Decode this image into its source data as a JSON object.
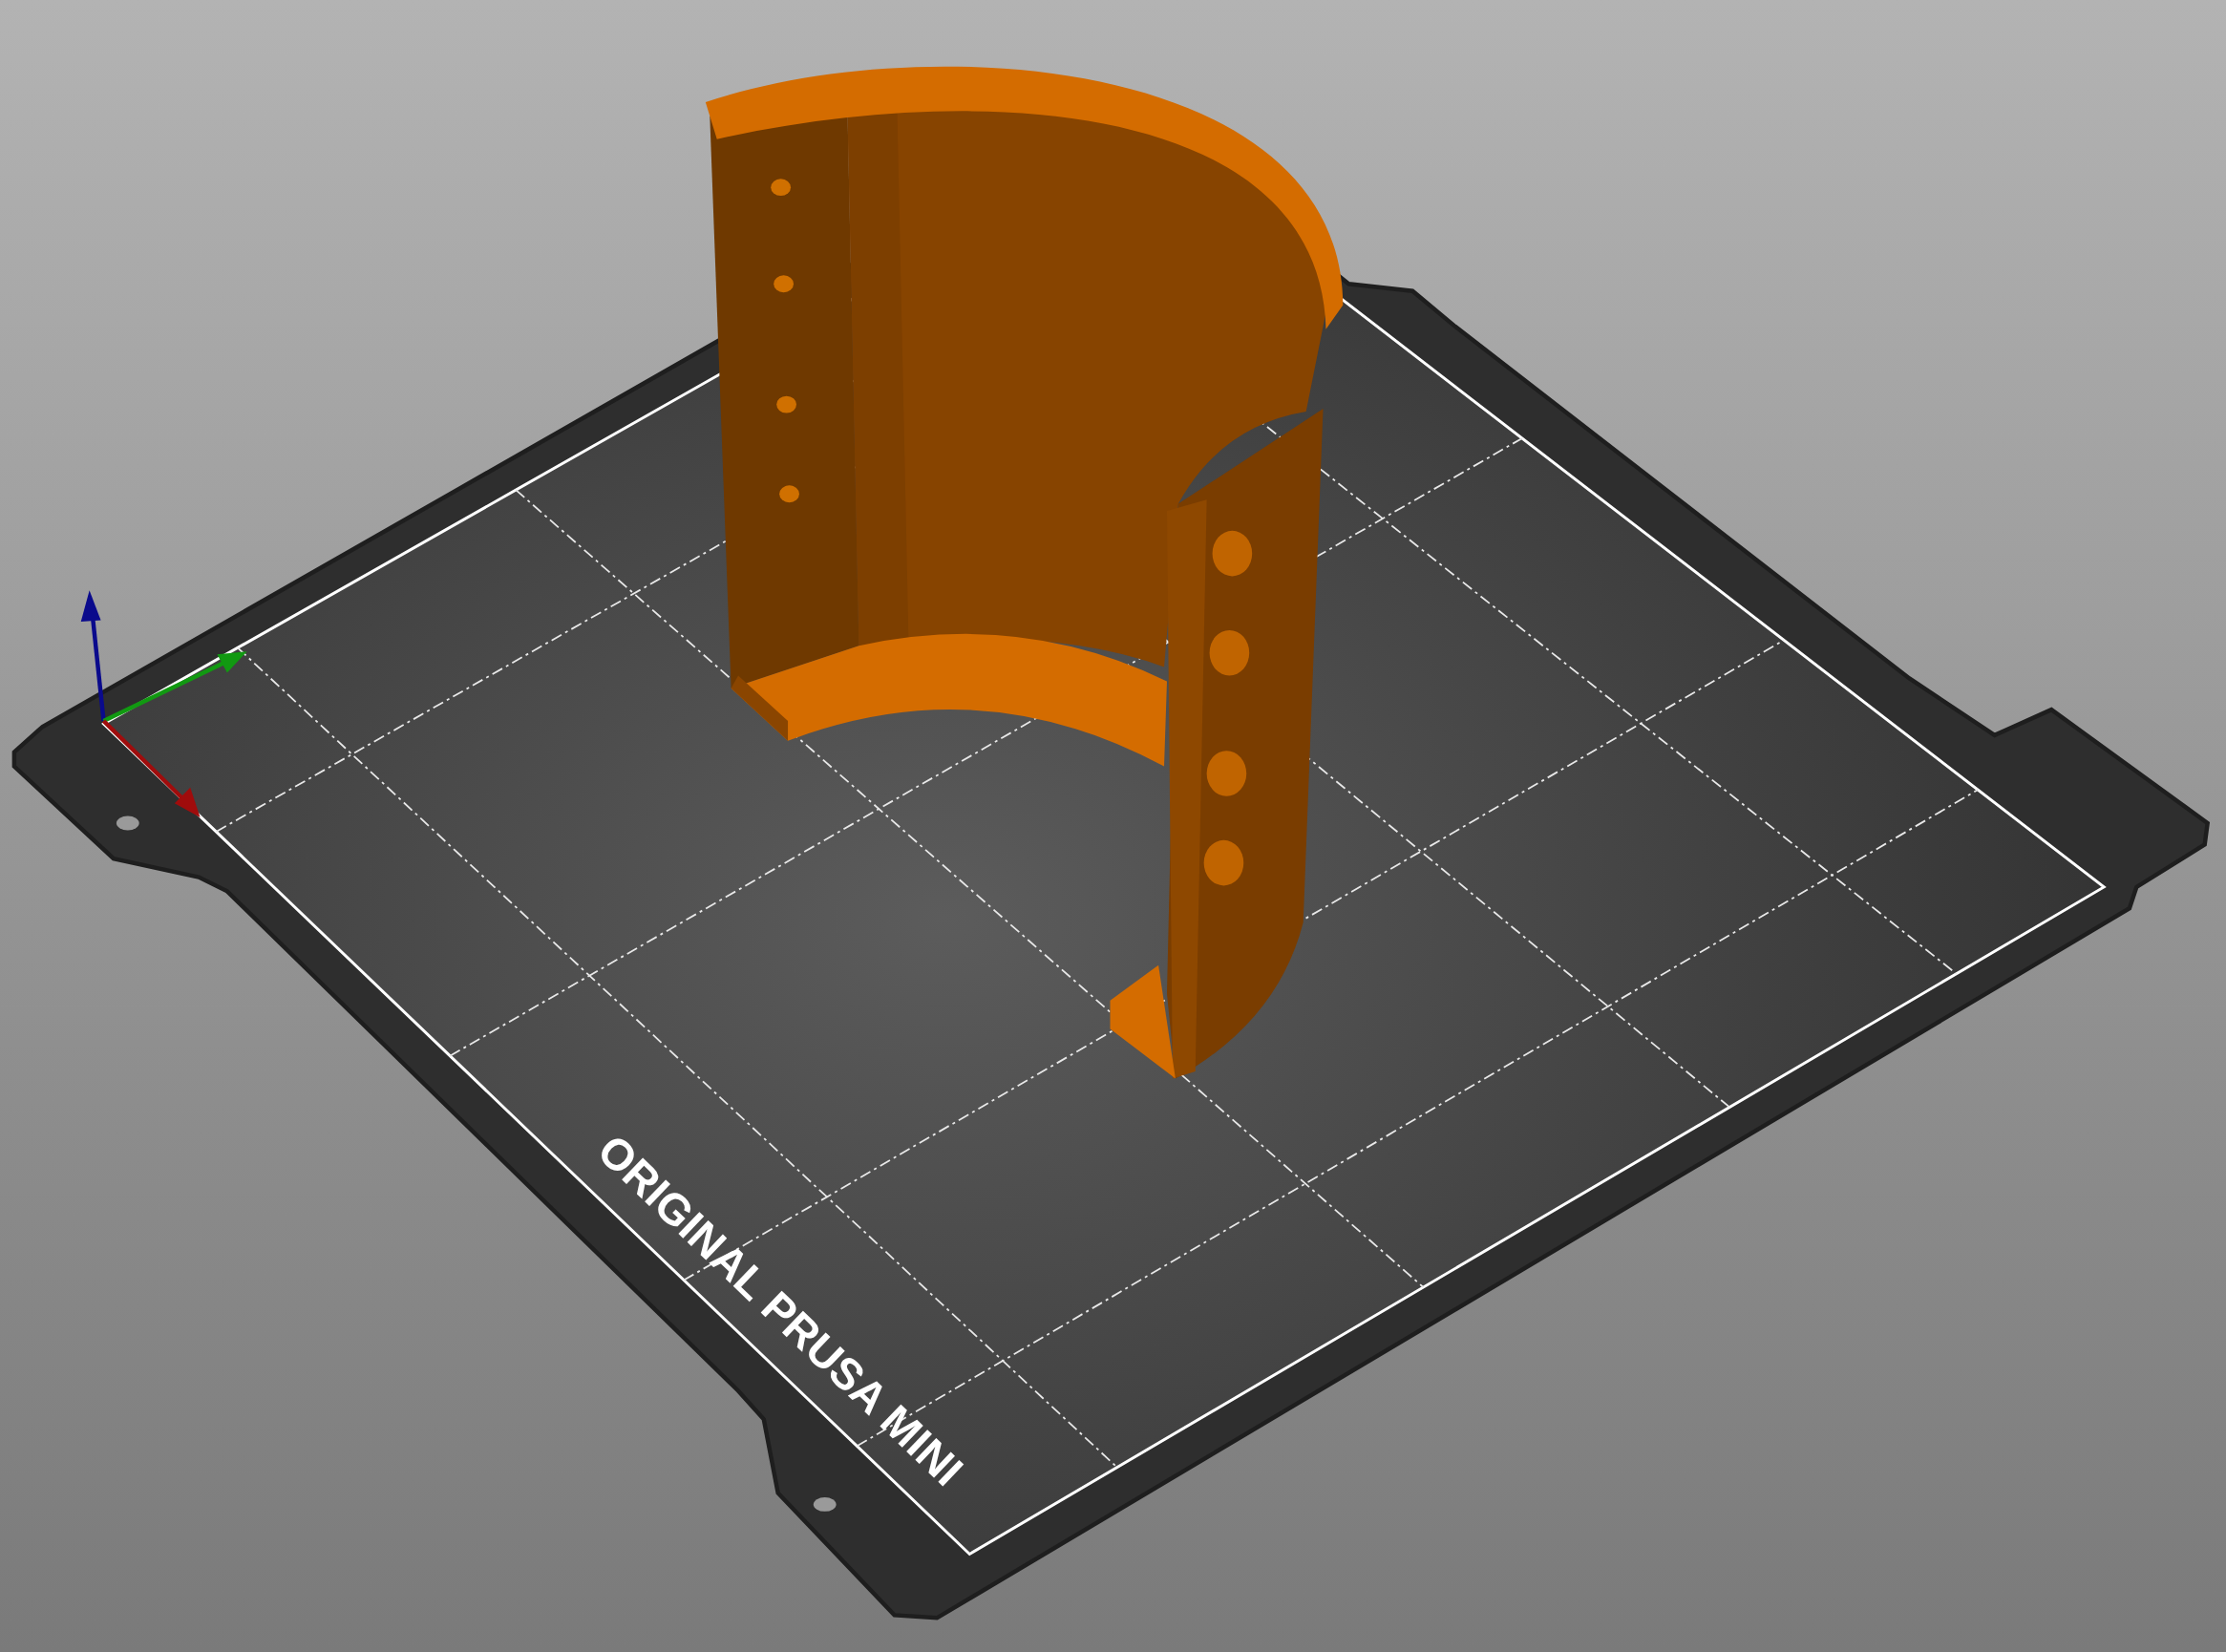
{
  "viewport": {
    "bed_label": "ORIGINAL PRUSA MINI"
  }
}
